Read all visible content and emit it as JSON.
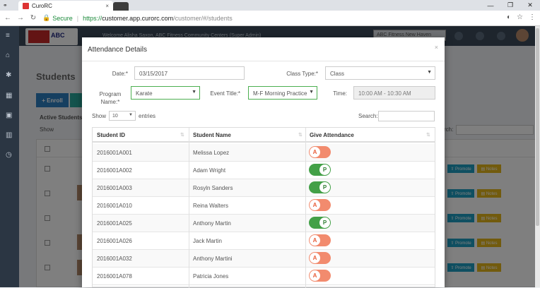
{
  "browser": {
    "tab_title": "CuroRC",
    "tab_close": "×",
    "secure_label": "Secure",
    "url_protocol": "https://",
    "url_host": "customer.app.curorc.com",
    "url_path": "/customer/#/students",
    "minimize": "—",
    "maximize": "❐",
    "close": "✕"
  },
  "app": {
    "welcome": "Welcome Alisha Saxon, ABC Fitness Community Centers (Super Admin)",
    "location_select": "ABC Fitness New Haven",
    "page_title": "Students",
    "enroll_label": "+ Enroll",
    "active_students_label": "Active Students",
    "show_label": "Show",
    "search_label": "rch:",
    "promote_label": "⇧ Promote",
    "notes_label": "▤ Notes"
  },
  "modal": {
    "title": "Attendance Details",
    "close": "×",
    "date_label": "Date:*",
    "date_value": "03/15/2017",
    "class_type_label": "Class Type:*",
    "class_type_value": "Class",
    "program_label_1": "Program",
    "program_label_2": "Name:*",
    "program_value": "Karate",
    "event_title_label": "Event Title:*",
    "event_title_value": "M-F Morning Practice",
    "time_label": "Time:",
    "time_value": "10:00 AM - 10:30 AM",
    "show_label": "Show",
    "show_value": "10",
    "entries_label": "entries",
    "search_label": "Search:"
  },
  "table": {
    "headers": [
      "Student ID",
      "Student Name",
      "Give Attendance"
    ],
    "rows": [
      {
        "id": "2016001A001",
        "name": "Melissa Lopez",
        "status": "A"
      },
      {
        "id": "2016001A002",
        "name": "Adam Wright",
        "status": "P"
      },
      {
        "id": "2016001A003",
        "name": "Rosyln Sanders",
        "status": "P"
      },
      {
        "id": "2016001A010",
        "name": "Reina Walters",
        "status": "A"
      },
      {
        "id": "2016001A025",
        "name": "Anthony Martin",
        "status": "P"
      },
      {
        "id": "2016001A026",
        "name": "Jack Martin",
        "status": "A"
      },
      {
        "id": "2016001A032",
        "name": "Anthony Martini",
        "status": "A"
      },
      {
        "id": "2016001A078",
        "name": "Patricia Jones",
        "status": "A"
      }
    ]
  },
  "colors": {
    "absent": "#f28b6e",
    "present": "#43a047",
    "sidebar": "#2b3643",
    "topbar": "#3c4a5a"
  }
}
